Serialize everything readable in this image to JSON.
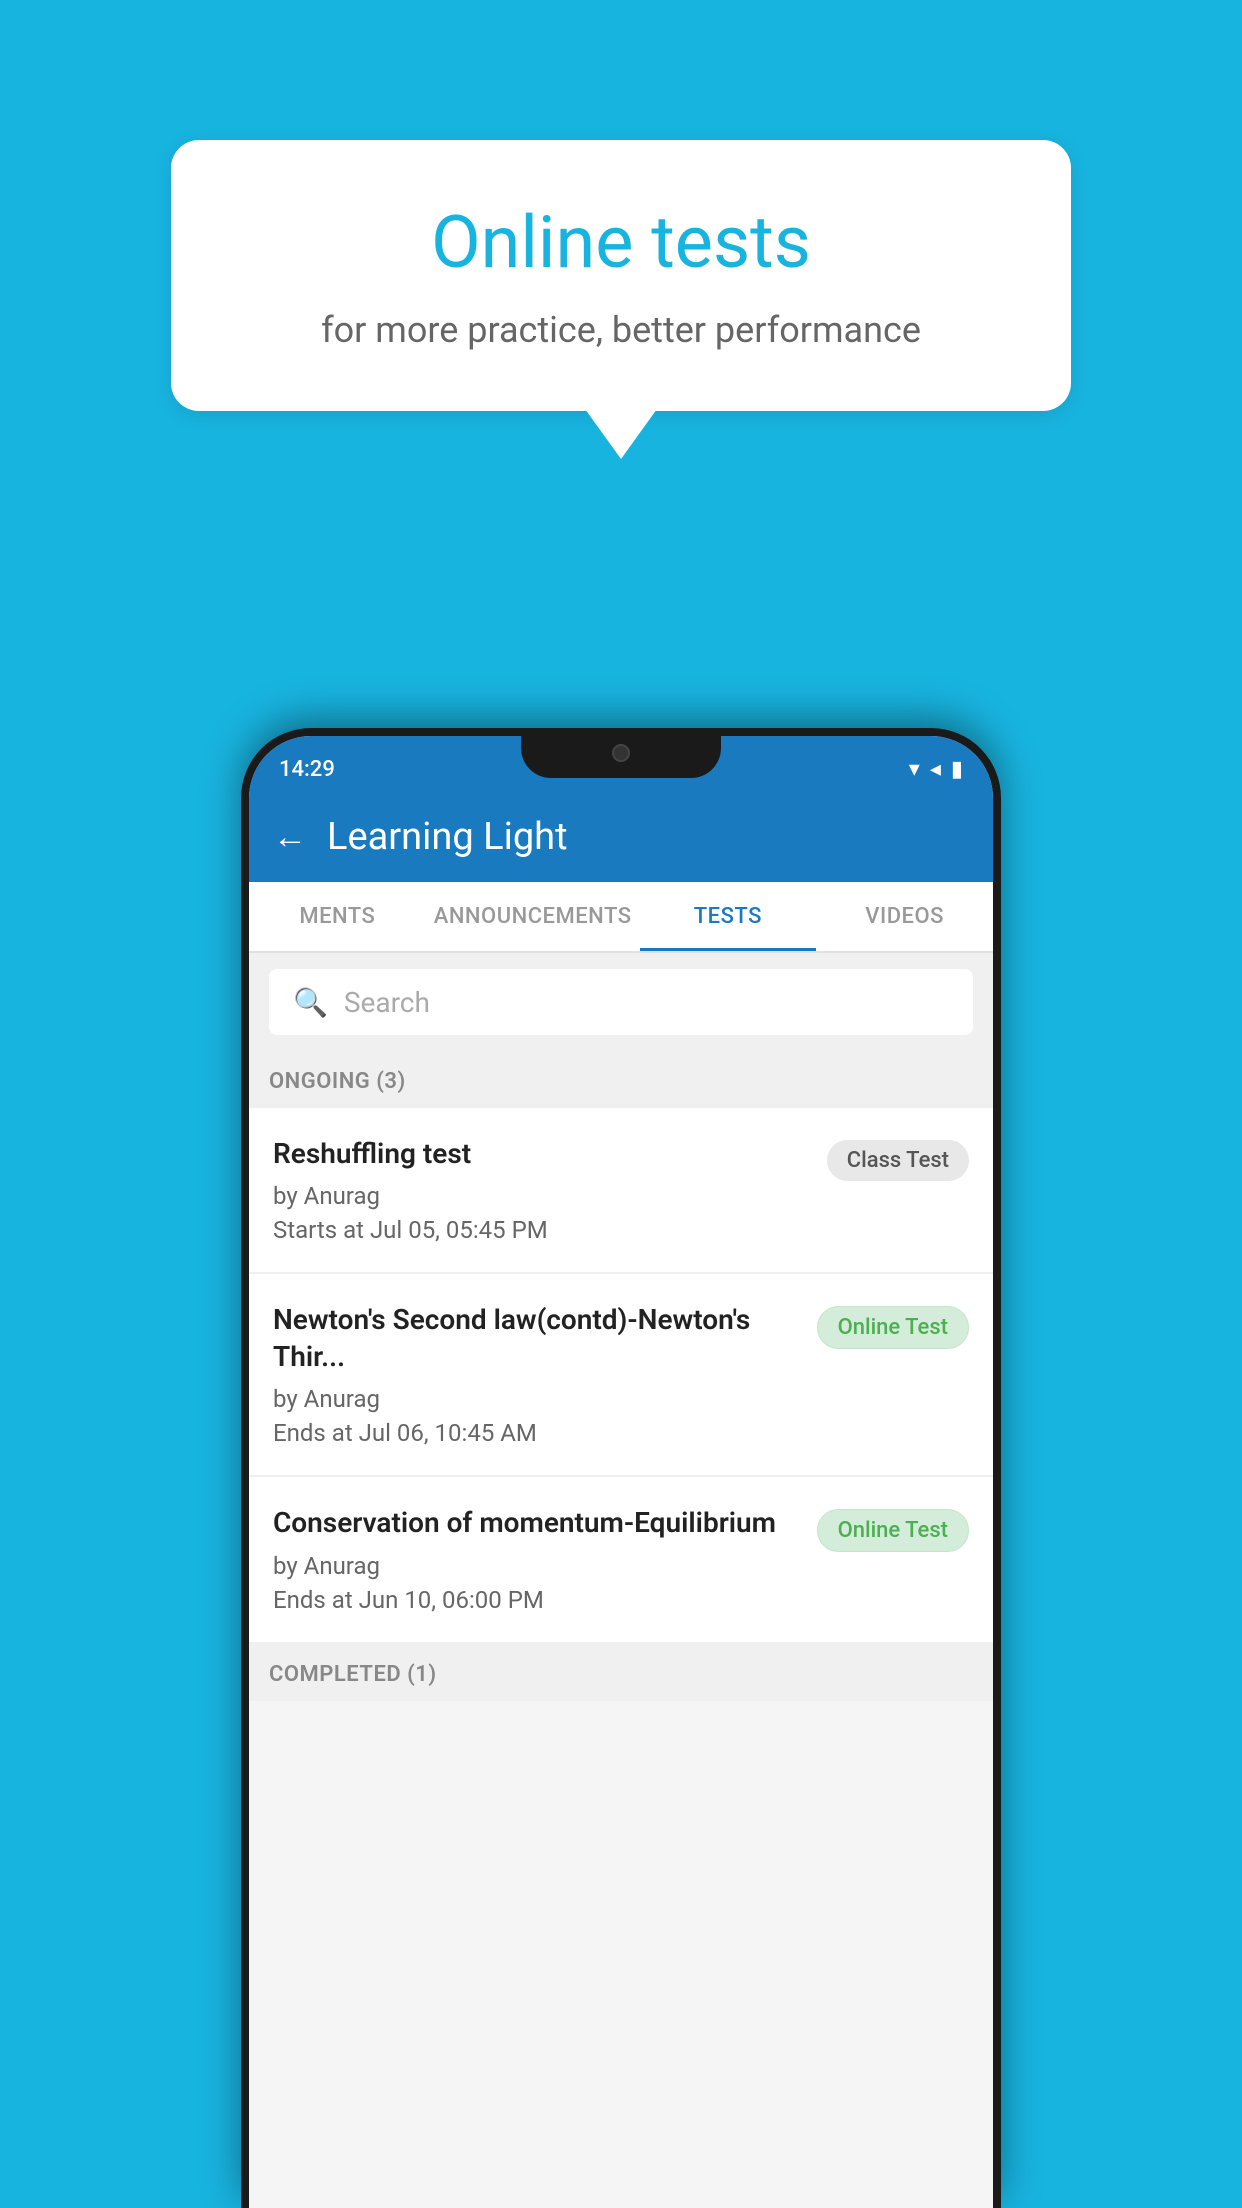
{
  "background": {
    "color": "#18b4e0"
  },
  "speech_bubble": {
    "title": "Online tests",
    "subtitle": "for more practice, better performance"
  },
  "phone": {
    "status_bar": {
      "time": "14:29",
      "icons": [
        "wifi",
        "signal",
        "battery"
      ]
    },
    "header": {
      "back_label": "←",
      "title": "Learning Light"
    },
    "tabs": [
      {
        "label": "MENTS",
        "active": false
      },
      {
        "label": "ANNOUNCEMENTS",
        "active": false
      },
      {
        "label": "TESTS",
        "active": true
      },
      {
        "label": "VIDEOS",
        "active": false
      }
    ],
    "search": {
      "placeholder": "Search"
    },
    "sections": [
      {
        "heading": "ONGOING (3)",
        "items": [
          {
            "name": "Reshuffling test",
            "author": "by Anurag",
            "time_label": "Starts at",
            "time": "Jul 05, 05:45 PM",
            "badge": "Class Test",
            "badge_type": "class"
          },
          {
            "name": "Newton's Second law(contd)-Newton's Thir...",
            "author": "by Anurag",
            "time_label": "Ends at",
            "time": "Jul 06, 10:45 AM",
            "badge": "Online Test",
            "badge_type": "online"
          },
          {
            "name": "Conservation of momentum-Equilibrium",
            "author": "by Anurag",
            "time_label": "Ends at",
            "time": "Jun 10, 06:00 PM",
            "badge": "Online Test",
            "badge_type": "online"
          }
        ]
      }
    ],
    "completed_section": {
      "heading": "COMPLETED (1)"
    }
  }
}
